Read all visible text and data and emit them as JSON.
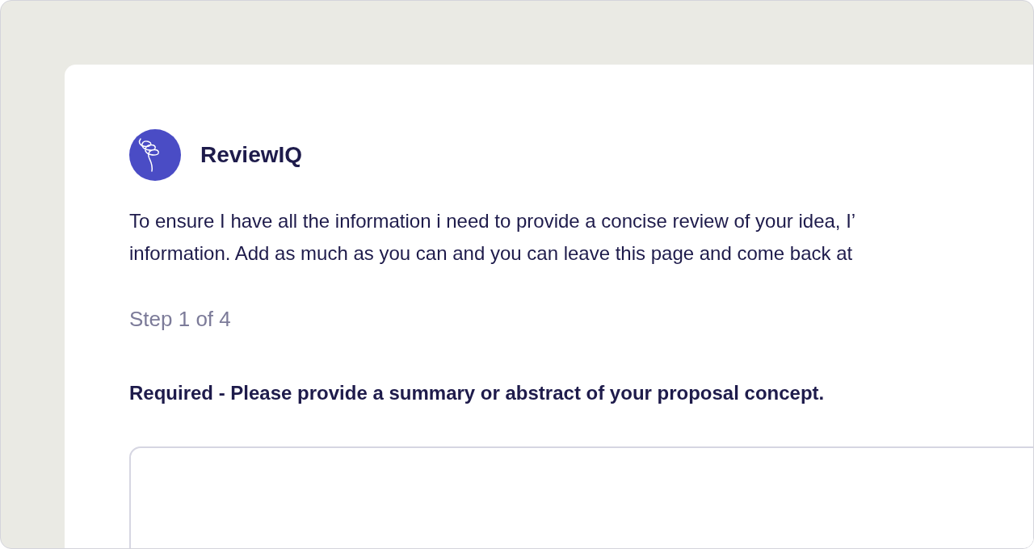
{
  "brand": {
    "name": "ReviewIQ"
  },
  "intro_lines": [
    "To ensure I have all the information i need to provide a concise review of your idea, I’",
    "information. Add as much as you can and you can leave this page and come back at"
  ],
  "step": "Step 1 of 4",
  "question": {
    "label": "Required - Please provide a summary or abstract of your proposal concept."
  }
}
